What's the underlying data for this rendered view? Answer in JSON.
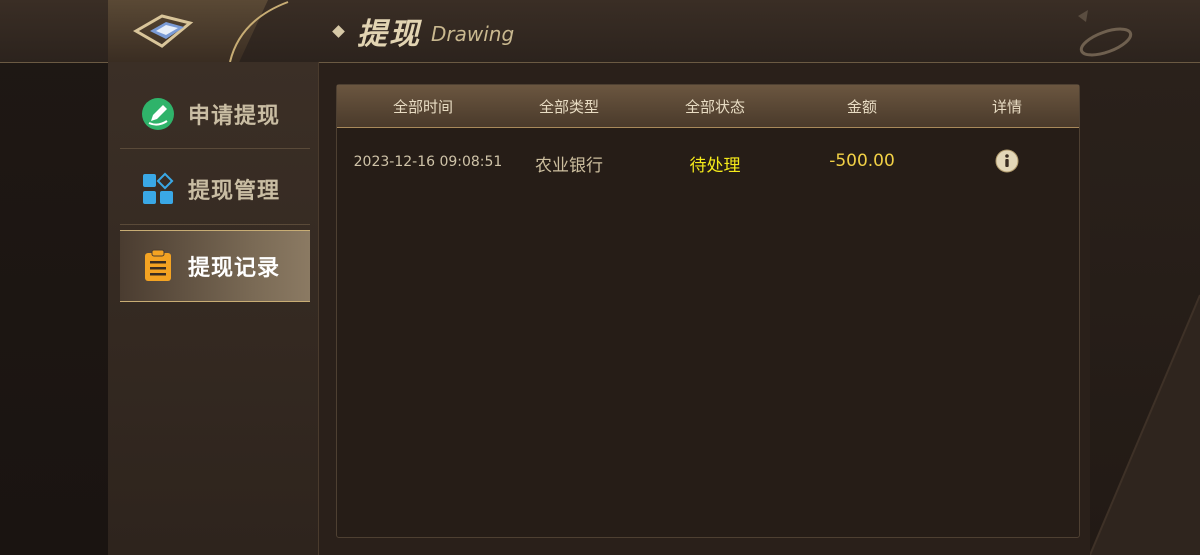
{
  "header": {
    "title": "提现",
    "subtitle": "Drawing"
  },
  "sidebar": {
    "items": [
      {
        "label": "申请提现",
        "icon": "edit-circle-icon",
        "active": false
      },
      {
        "label": "提现管理",
        "icon": "grid-manage-icon",
        "active": false
      },
      {
        "label": "提现记录",
        "icon": "clipboard-icon",
        "active": true
      }
    ]
  },
  "table": {
    "headers": {
      "time": "全部时间",
      "type": "全部类型",
      "status": "全部状态",
      "amount": "金额",
      "detail": "详情"
    },
    "rows": [
      {
        "time": "2023-12-16 09:08:51",
        "type": "农业银行",
        "status": "待处理",
        "amount": "-500.00",
        "detail_icon": "info-icon"
      }
    ]
  },
  "colors": {
    "status_pending": "#f5ea1a",
    "amount": "#f1d046",
    "accent_gold": "#c8ad74",
    "icon_green": "#2fb36a",
    "icon_blue": "#3aa8e6",
    "icon_orange": "#f4a322"
  }
}
